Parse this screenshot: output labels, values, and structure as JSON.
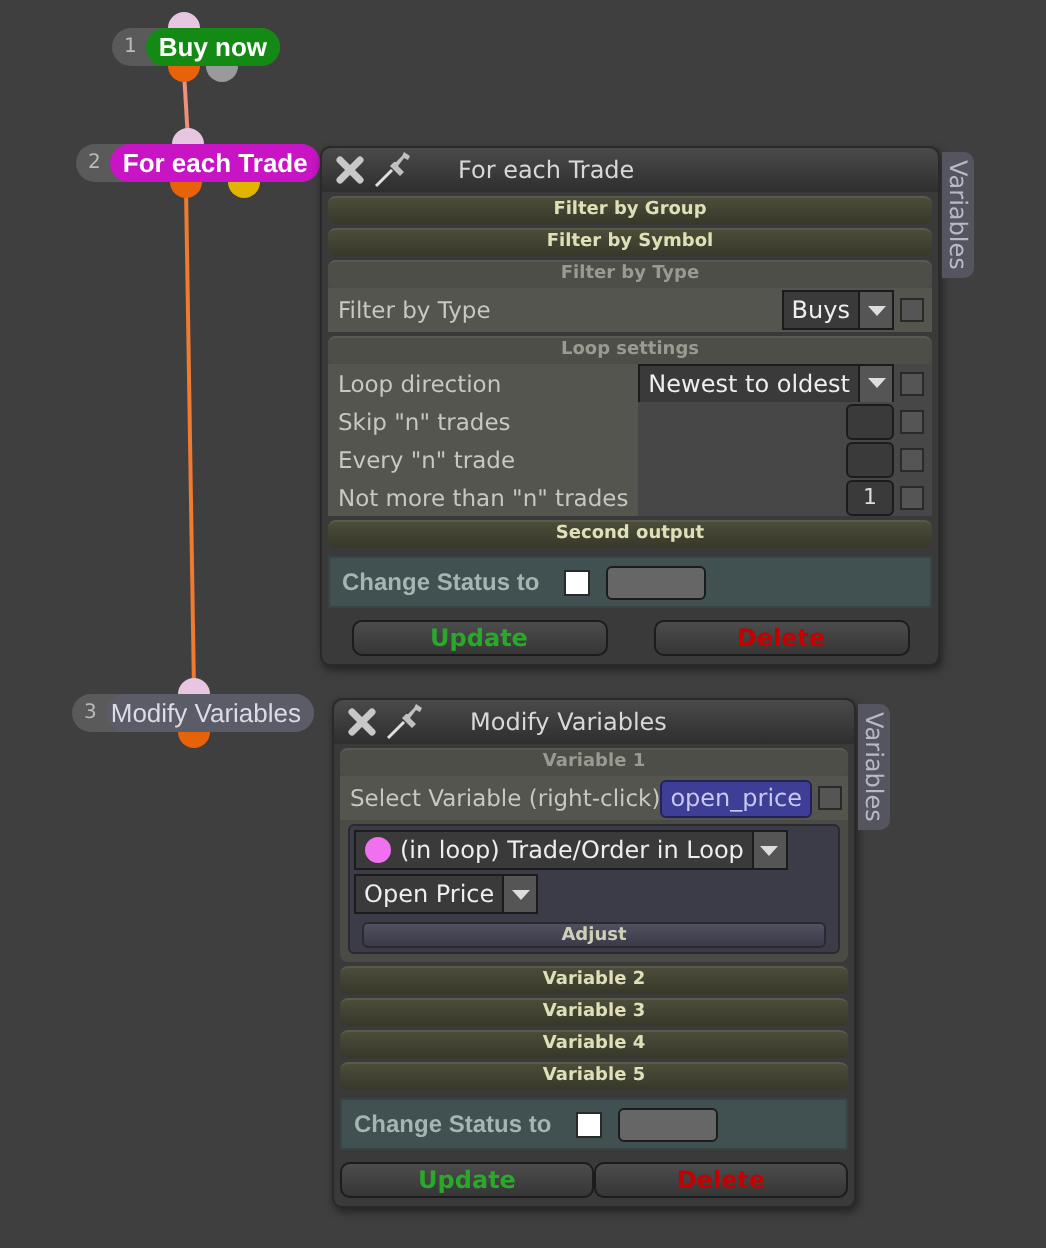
{
  "nodes": [
    {
      "number": "1",
      "label": "Buy now",
      "color": "#138a13",
      "outputs": [
        {
          "color": "#e8620a"
        },
        {
          "color": "#9a9a9a"
        }
      ]
    },
    {
      "number": "2",
      "label": "For each Trade",
      "color": "#c814c4",
      "outputs": [
        {
          "color": "#e8620a"
        },
        {
          "color": "#e0b400"
        }
      ]
    },
    {
      "number": "3",
      "label": "Modify Variables",
      "color": "#5c5c68",
      "outputs": [
        {
          "color": "#e8620a"
        }
      ]
    }
  ],
  "panels": [
    {
      "title": "For each Trade",
      "side_tab": "Variables",
      "sections": [
        {
          "title": "Filter by Group",
          "expanded": false
        },
        {
          "title": "Filter by Symbol",
          "expanded": false
        },
        {
          "title": "Filter by Type",
          "expanded": true,
          "rows": [
            {
              "kind": "dropdown",
              "label": "Filter by Type",
              "value": "Buys",
              "checked": false
            }
          ]
        },
        {
          "title": "Loop settings",
          "expanded": true,
          "rows": [
            {
              "kind": "dropdown",
              "label": "Loop direction",
              "value": "Newest to oldest",
              "checked": false
            },
            {
              "kind": "number",
              "label": "Skip \"n\" trades",
              "checked": false
            },
            {
              "kind": "number",
              "label": "Every \"n\" trade",
              "checked": false
            },
            {
              "kind": "number",
              "label": "Not more than \"n\" trades",
              "value": "1",
              "checked": false
            }
          ]
        },
        {
          "title": "Second output",
          "expanded": false
        }
      ],
      "status": {
        "label": "Change Status to",
        "checked": false
      },
      "buttons": [
        {
          "label": "Update",
          "kind": "update"
        },
        {
          "label": "Delete",
          "kind": "delete"
        }
      ]
    },
    {
      "title": "Modify Variables",
      "side_tab": "Variables",
      "sections": [
        {
          "title": "Variable 1",
          "expanded": true,
          "rows": [
            {
              "kind": "variable",
              "label": "Select Variable (right-click)",
              "value": "open_price",
              "checked": false
            },
            {
              "kind": "source",
              "source": "(in loop) Trade/Order in Loop",
              "field": "Open Price",
              "action": "Adjust"
            }
          ]
        },
        {
          "title": "Variable 2",
          "expanded": false
        },
        {
          "title": "Variable 3",
          "expanded": false
        },
        {
          "title": "Variable 4",
          "expanded": false
        },
        {
          "title": "Variable 5",
          "expanded": false
        }
      ],
      "status": {
        "label": "Change Status to",
        "checked": false
      },
      "buttons": [
        {
          "label": "Update",
          "kind": "update"
        },
        {
          "label": "Delete",
          "kind": "delete"
        }
      ]
    }
  ]
}
